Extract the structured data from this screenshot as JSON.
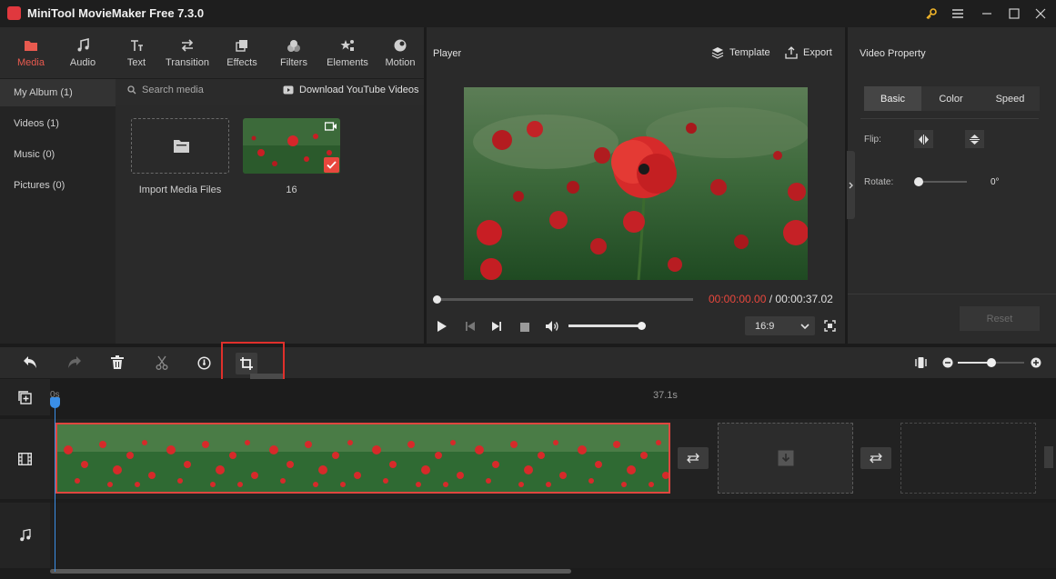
{
  "app": {
    "title": "MiniTool MovieMaker Free 7.3.0"
  },
  "window_controls": [
    "key-icon",
    "menu-icon",
    "minimize-icon",
    "maximize-icon",
    "close-icon"
  ],
  "tabs": [
    {
      "label": "Media",
      "icon": "media-folder-icon"
    },
    {
      "label": "Audio",
      "icon": "music-note-icon"
    },
    {
      "label": "Text",
      "icon": "text-icon"
    },
    {
      "label": "Transition",
      "icon": "transition-icon"
    },
    {
      "label": "Effects",
      "icon": "effects-icon"
    },
    {
      "label": "Filters",
      "icon": "filters-icon"
    },
    {
      "label": "Elements",
      "icon": "elements-icon"
    },
    {
      "label": "Motion",
      "icon": "motion-icon"
    }
  ],
  "sidebar": {
    "items": [
      {
        "label": "My Album (1)"
      },
      {
        "label": "Videos (1)"
      },
      {
        "label": "Music (0)"
      },
      {
        "label": "Pictures (0)"
      }
    ]
  },
  "library": {
    "search_placeholder": "Search media",
    "download_label": "Download YouTube Videos",
    "import_label": "Import Media Files",
    "clip_name": "16"
  },
  "player": {
    "title": "Player",
    "template_label": "Template",
    "export_label": "Export",
    "current_time": "00:00:00.00",
    "separator": " / ",
    "total_time": "00:00:37.02",
    "aspect_ratio": "16:9",
    "progress": 0.0,
    "volume": 0.95,
    "accent_color": "#e8473d"
  },
  "property": {
    "title": "Video Property",
    "tabs": [
      "Basic",
      "Color",
      "Speed"
    ],
    "flip_label": "Flip:",
    "rotate_label": "Rotate:",
    "rotate_value": "0°",
    "reset_label": "Reset"
  },
  "toolbar": {
    "crop_tooltip": "Crop",
    "zoom_level": 0.5
  },
  "timeline": {
    "start_label": "0s",
    "end_label": "37.1s"
  }
}
